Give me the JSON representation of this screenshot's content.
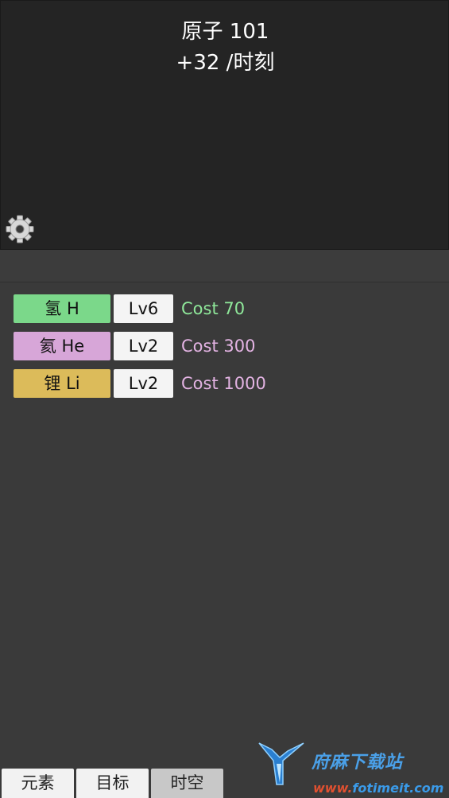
{
  "header": {
    "atom_count": "原子 101",
    "rate": "+32 /时刻"
  },
  "settings": {
    "icon": "gear-icon"
  },
  "elements": [
    {
      "label": "氢 H",
      "level": "Lv6",
      "cost": "Cost 70",
      "color": "#7bd88a",
      "cost_color": "#8fe89a"
    },
    {
      "label": "氦 He",
      "level": "Lv2",
      "cost": "Cost 300",
      "color": "#d7a6d8",
      "cost_color": "#e3b3e3"
    },
    {
      "label": "锂 Li",
      "level": "Lv2",
      "cost": "Cost 1000",
      "color": "#dcbb5a",
      "cost_color": "#e3b3e3"
    }
  ],
  "tabs": [
    {
      "label": "元素",
      "active": false
    },
    {
      "label": "目标",
      "active": false
    },
    {
      "label": "时空",
      "active": true
    }
  ],
  "watermark": {
    "brand": "府麻下载站",
    "url_prefix": "www.",
    "url_domain": "fotimeit.com"
  }
}
